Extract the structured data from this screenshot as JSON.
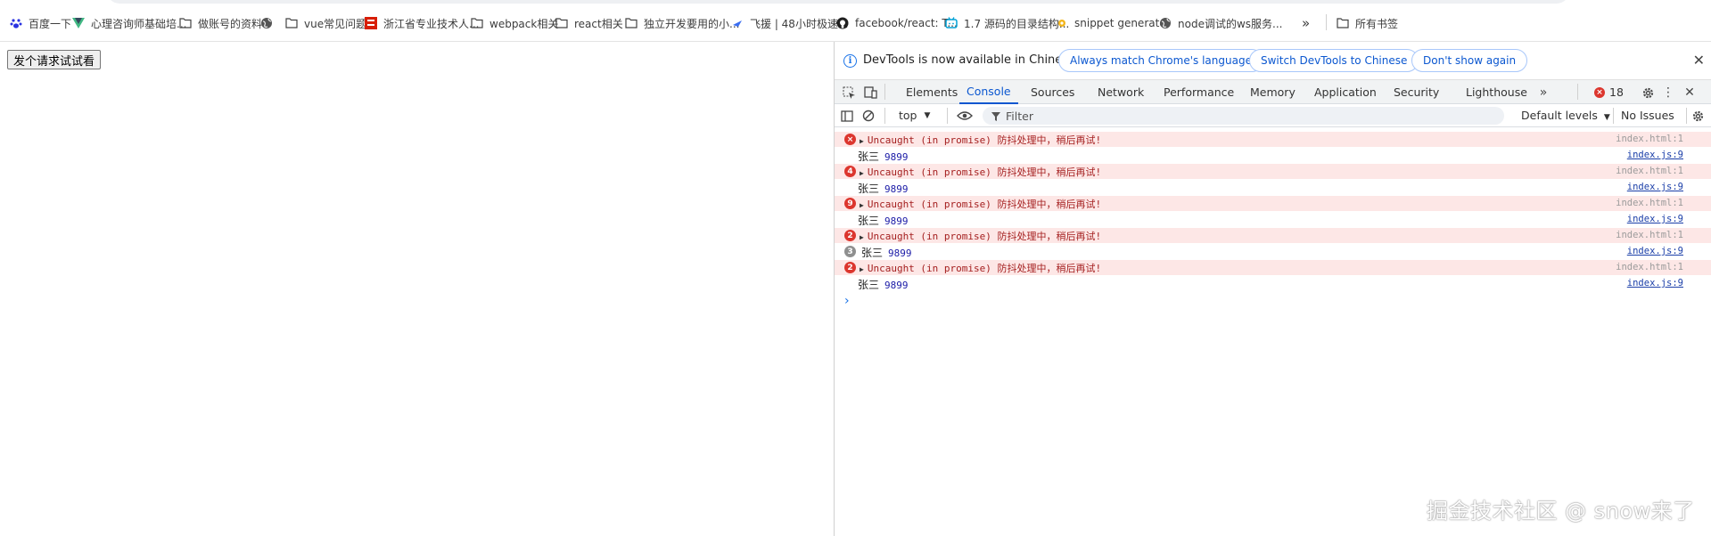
{
  "bookmarks": [
    {
      "label": "百度一下",
      "icon": "baidu-paw-icon"
    },
    {
      "label": "心理咨询师基础培...",
      "icon": "vue-logo-icon"
    },
    {
      "label": "做账号的资料",
      "icon": "folder-icon"
    },
    {
      "label": "",
      "icon": "globe-icon"
    },
    {
      "label": "vue常见问题",
      "icon": "folder-icon"
    },
    {
      "label": "浙江省专业技术人...",
      "icon": "red-seal-icon"
    },
    {
      "label": "webpack相关",
      "icon": "folder-icon"
    },
    {
      "label": "react相关",
      "icon": "folder-icon"
    },
    {
      "label": "独立开发要用的小...",
      "icon": "folder-icon"
    },
    {
      "label": "飞援 | 48小时极速...",
      "icon": "feiyuan-icon"
    },
    {
      "label": "facebook/react: T...",
      "icon": "github-icon"
    },
    {
      "label": "1.7 源码的目录结构...",
      "icon": "bilibili-icon"
    },
    {
      "label": "snippet generator",
      "icon": "snippet-icon"
    },
    {
      "label": "node调试的ws服务...",
      "icon": "globe-icon"
    }
  ],
  "bookmarks_more": "»",
  "bookmarks_all": "所有书签",
  "page": {
    "button_label": "发个请求试试看",
    "watermark": "掘金技术社区 @ snow来了"
  },
  "devtools": {
    "infobar": {
      "text": "DevTools is now available in Chinese!",
      "btn_match": "Always match Chrome's language",
      "btn_switch": "Switch DevTools to Chinese",
      "btn_dismiss": "Don't show again"
    },
    "tabs": [
      "Elements",
      "Console",
      "Sources",
      "Network",
      "Performance",
      "Memory",
      "Application",
      "Security",
      "Lighthouse"
    ],
    "active_tab": "Console",
    "error_count": "18",
    "toolbar": {
      "context": "top",
      "filter_placeholder": "Filter",
      "levels": "Default levels",
      "issues": "No Issues"
    },
    "console_rows": [
      {
        "type": "error",
        "badge": "",
        "text": "Uncaught (in promise) 防抖处理中，稍后再试!",
        "source": "index.html:1"
      },
      {
        "type": "log",
        "badge": "",
        "name": "张三",
        "num": "9899",
        "source": "index.js:9"
      },
      {
        "type": "error",
        "badge": "4",
        "text": "Uncaught (in promise) 防抖处理中，稍后再试!",
        "source": "index.html:1"
      },
      {
        "type": "log",
        "badge": "",
        "name": "张三",
        "num": "9899",
        "source": "index.js:9"
      },
      {
        "type": "error",
        "badge": "9",
        "text": "Uncaught (in promise) 防抖处理中，稍后再试!",
        "source": "index.html:1"
      },
      {
        "type": "log",
        "badge": "",
        "name": "张三",
        "num": "9899",
        "source": "index.js:9"
      },
      {
        "type": "error",
        "badge": "2",
        "text": "Uncaught (in promise) 防抖处理中，稍后再试!",
        "source": "index.html:1"
      },
      {
        "type": "log",
        "badge": "3",
        "name": "张三",
        "num": "9899",
        "source": "index.js:9"
      },
      {
        "type": "error",
        "badge": "2",
        "text": "Uncaught (in promise) 防抖处理中，稍后再试!",
        "source": "index.html:1"
      },
      {
        "type": "log",
        "badge": "",
        "name": "张三",
        "num": "9899",
        "source": "index.js:9"
      }
    ],
    "prompt_symbol": "›"
  },
  "colors": {
    "accent_blue": "#0b57d0",
    "error_red": "#dc362e",
    "error_row_bg": "#fde7e6"
  }
}
